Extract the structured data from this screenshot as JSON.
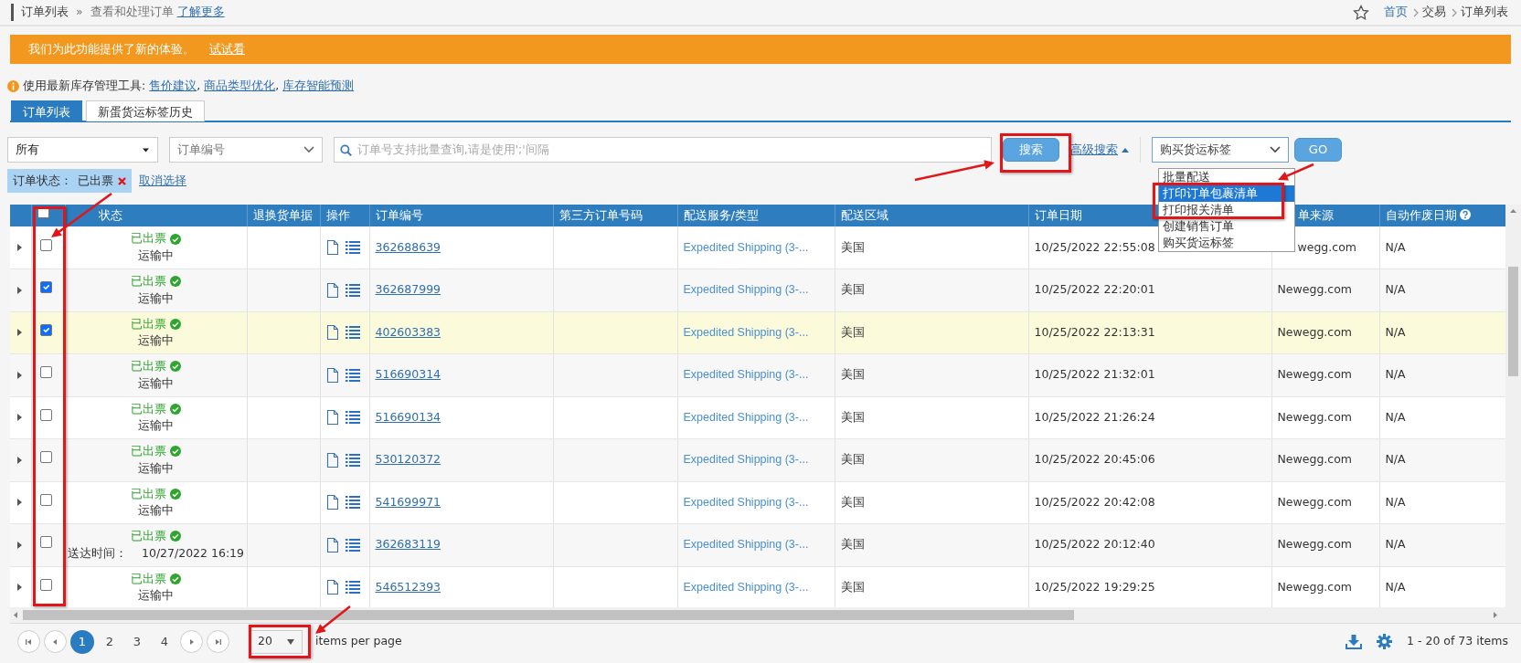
{
  "header": {
    "title": "订单列表",
    "separator": "»",
    "subtitle": "查看和处理订单",
    "learn_more": "了解更多",
    "breadcrumbs": [
      "首页",
      "交易",
      "订单列表"
    ]
  },
  "banner": {
    "text": "我们为此功能提供了新的体验。",
    "link": "试试看"
  },
  "tools": {
    "label": "使用最新库存管理工具:",
    "links": [
      "售价建议",
      "商品类型优化",
      "库存智能预测"
    ],
    "separator": ","
  },
  "tabs": [
    {
      "label": "订单列表",
      "selected": true
    },
    {
      "label": "新蛋货运标签历史",
      "selected": false
    }
  ],
  "filters": {
    "status_select": "所有",
    "field_select": "订单编号",
    "search_placeholder": "订单号支持批量查询,请是使用';'间隔",
    "search_button": "搜索",
    "advanced": "高级搜索",
    "action_select": "购买货运标签",
    "go": "GO"
  },
  "chip": {
    "label": "订单状态：",
    "value": "已出票",
    "clear": "取消选择"
  },
  "action_menu": [
    {
      "label": "批量配送",
      "selected": false
    },
    {
      "label": "打印订单包裹清单",
      "selected": true
    },
    {
      "label": "打印报关清单",
      "selected": false
    },
    {
      "label": "创建销售订单",
      "selected": false
    },
    {
      "label": "购买货运标签",
      "selected": false
    }
  ],
  "table": {
    "select_all": false,
    "columns": [
      "状态",
      "退换货单据",
      "操作",
      "订单编号",
      "第三方订单号码",
      "配送服务/类型",
      "配送区域",
      "订单日期",
      "单来源",
      "自动作废日期"
    ],
    "rows": [
      {
        "checked": false,
        "highlighted": false,
        "status": "已出票",
        "note": "运输中",
        "order_no": "362688639",
        "service": "Expedited Shipping (3-...",
        "region": "美国",
        "date": "10/25/2022 22:55:08",
        "source": "wegg.com",
        "void_date": "N/A"
      },
      {
        "checked": true,
        "highlighted": false,
        "status": "已出票",
        "note": "运输中",
        "order_no": "362687999",
        "service": "Expedited Shipping (3-...",
        "region": "美国",
        "date": "10/25/2022 22:20:01",
        "source": "Newegg.com",
        "void_date": "N/A"
      },
      {
        "checked": true,
        "highlighted": true,
        "status": "已出票",
        "note": "运输中",
        "order_no": "402603383",
        "service": "Expedited Shipping (3-...",
        "region": "美国",
        "date": "10/25/2022 22:13:31",
        "source": "Newegg.com",
        "void_date": "N/A"
      },
      {
        "checked": false,
        "highlighted": false,
        "status": "已出票",
        "note": "运输中",
        "order_no": "516690314",
        "service": "Expedited Shipping (3-...",
        "region": "美国",
        "date": "10/25/2022 21:32:01",
        "source": "Newegg.com",
        "void_date": "N/A"
      },
      {
        "checked": false,
        "highlighted": false,
        "status": "已出票",
        "note": "运输中",
        "order_no": "516690134",
        "service": "Expedited Shipping (3-...",
        "region": "美国",
        "date": "10/25/2022 21:26:24",
        "source": "Newegg.com",
        "void_date": "N/A"
      },
      {
        "checked": false,
        "highlighted": false,
        "status": "已出票",
        "note": "运输中",
        "order_no": "530120372",
        "service": "Expedited Shipping (3-...",
        "region": "美国",
        "date": "10/25/2022 20:45:06",
        "source": "Newegg.com",
        "void_date": "N/A"
      },
      {
        "checked": false,
        "highlighted": false,
        "status": "已出票",
        "note": "运输中",
        "order_no": "541699971",
        "service": "Expedited Shipping (3-...",
        "region": "美国",
        "date": "10/25/2022 20:42:08",
        "source": "Newegg.com",
        "void_date": "N/A"
      },
      {
        "checked": false,
        "highlighted": false,
        "status": "已出票",
        "note": "送达时间：",
        "note_date": "10/27/2022 16:19",
        "order_no": "362683119",
        "service": "Expedited Shipping (3-...",
        "region": "美国",
        "date": "10/25/2022 20:12:40",
        "source": "Newegg.com",
        "void_date": "N/A"
      },
      {
        "checked": false,
        "highlighted": false,
        "status": "已出票",
        "note": "运输中",
        "order_no": "546512393",
        "service": "Expedited Shipping (3-...",
        "region": "美国",
        "date": "10/25/2022 19:29:25",
        "source": "Newegg.com",
        "void_date": "N/A"
      }
    ]
  },
  "pager": {
    "pages": [
      {
        "label": "1",
        "selected": true
      },
      {
        "label": "2",
        "selected": false
      },
      {
        "label": "3",
        "selected": false
      },
      {
        "label": "4",
        "selected": false
      }
    ],
    "page_size": "20",
    "per_page": "items per page",
    "summary": "1 - 20 of 73 items"
  }
}
